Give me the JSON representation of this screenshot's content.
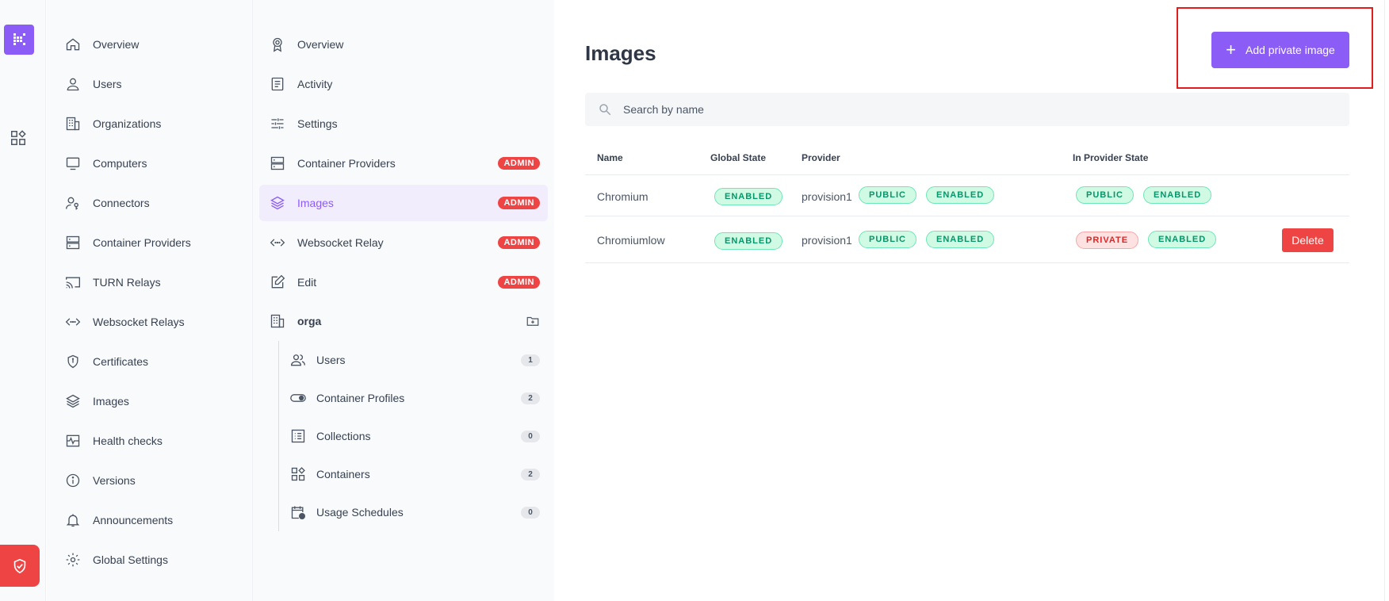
{
  "rail": {
    "logo_icon": "kasm-logo-icon",
    "apps_icon": "apps-grid-icon",
    "shield_icon": "shield-check-icon",
    "accent": "#8b5cf6",
    "danger": "#ef4444"
  },
  "main_nav": {
    "items": [
      {
        "label": "Overview",
        "icon": "home-icon"
      },
      {
        "label": "Users",
        "icon": "user-icon"
      },
      {
        "label": "Organizations",
        "icon": "building-icon"
      },
      {
        "label": "Computers",
        "icon": "monitor-icon"
      },
      {
        "label": "Connectors",
        "icon": "user-key-icon"
      },
      {
        "label": "Container Providers",
        "icon": "server-icon"
      },
      {
        "label": "TURN Relays",
        "icon": "cast-icon"
      },
      {
        "label": "Websocket Relays",
        "icon": "code-arrows-icon"
      },
      {
        "label": "Certificates",
        "icon": "shield-icon"
      },
      {
        "label": "Images",
        "icon": "layers-icon"
      },
      {
        "label": "Health checks",
        "icon": "pulse-icon"
      },
      {
        "label": "Versions",
        "icon": "info-icon"
      },
      {
        "label": "Announcements",
        "icon": "bell-icon"
      },
      {
        "label": "Global Settings",
        "icon": "gear-icon"
      }
    ]
  },
  "sub_nav": {
    "items": [
      {
        "label": "Overview",
        "icon": "badge-icon",
        "badge": ""
      },
      {
        "label": "Activity",
        "icon": "document-icon",
        "badge": ""
      },
      {
        "label": "Settings",
        "icon": "sliders-icon",
        "badge": ""
      },
      {
        "label": "Container Providers",
        "icon": "server-icon",
        "badge": "ADMIN"
      },
      {
        "label": "Images",
        "icon": "layers-icon",
        "badge": "ADMIN"
      },
      {
        "label": "Websocket Relay",
        "icon": "code-arrows-icon",
        "badge": "ADMIN"
      },
      {
        "label": "Edit",
        "icon": "edit-icon",
        "badge": "ADMIN"
      }
    ],
    "org": {
      "name": "orga",
      "children": [
        {
          "label": "Users",
          "count": "1",
          "icon": "users-icon"
        },
        {
          "label": "Container Profiles",
          "count": "2",
          "icon": "toggle-icon"
        },
        {
          "label": "Collections",
          "count": "0",
          "icon": "list-icon"
        },
        {
          "label": "Containers",
          "count": "2",
          "icon": "apps-grid-icon"
        },
        {
          "label": "Usage Schedules",
          "count": "0",
          "icon": "calendar-clock-icon"
        }
      ]
    }
  },
  "content": {
    "title": "Images",
    "add_button_label": "Add private image",
    "search_placeholder": "Search by name",
    "columns": {
      "name": "Name",
      "global_state": "Global State",
      "provider": "Provider",
      "in_provider_state": "In Provider State"
    },
    "rows": [
      {
        "name": "Chromium",
        "global_state": "ENABLED",
        "provider": "provision1",
        "provider_visibility": "PUBLIC",
        "provider_state": "ENABLED",
        "in_provider_visibility": "PUBLIC",
        "in_provider_state": "ENABLED",
        "action": ""
      },
      {
        "name": "Chromiumlow",
        "global_state": "ENABLED",
        "provider": "provision1",
        "provider_visibility": "PUBLIC",
        "provider_state": "ENABLED",
        "in_provider_visibility": "PRIVATE",
        "in_provider_state": "ENABLED",
        "action": "Delete"
      }
    ]
  }
}
